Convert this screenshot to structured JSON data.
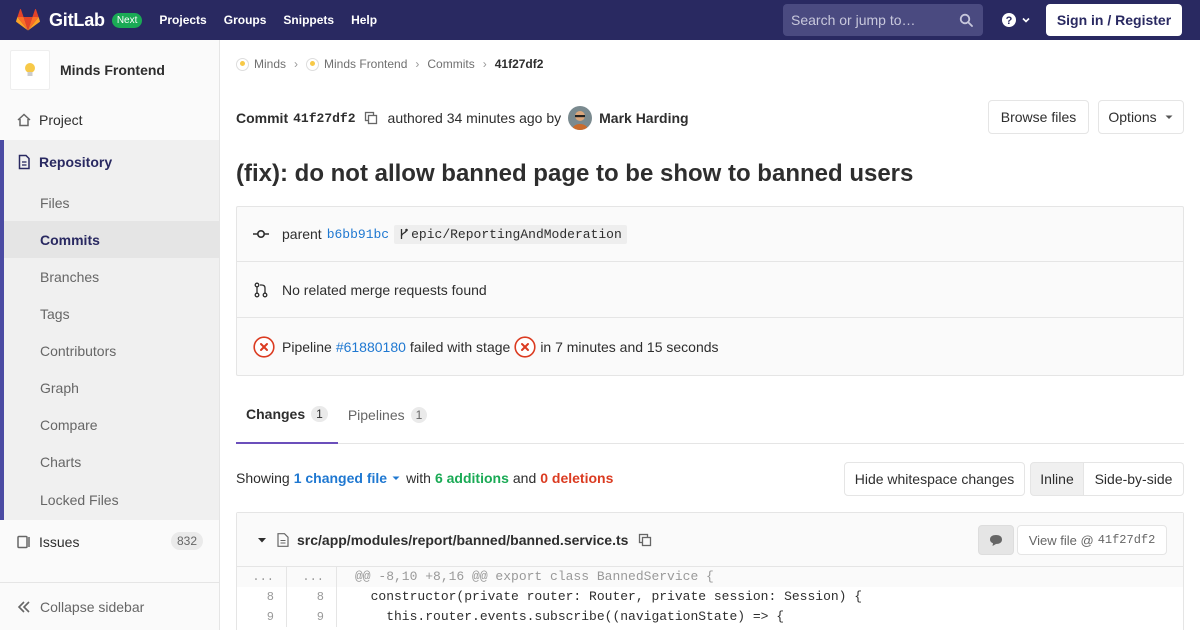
{
  "navbar": {
    "brand": "GitLab",
    "badge": "Next",
    "links": [
      "Projects",
      "Groups",
      "Snippets",
      "Help"
    ],
    "search_placeholder": "Search or jump to…",
    "signin": "Sign in / Register"
  },
  "sidebar": {
    "project_name": "Minds Frontend",
    "project_item": "Project",
    "repository": "Repository",
    "repo_items": [
      "Files",
      "Commits",
      "Branches",
      "Tags",
      "Contributors",
      "Graph",
      "Compare",
      "Charts",
      "Locked Files"
    ],
    "issues": "Issues",
    "issues_count": "832",
    "collapse": "Collapse sidebar"
  },
  "breadcrumb": [
    "Minds",
    "Minds Frontend",
    "Commits",
    "41f27df2"
  ],
  "commit": {
    "label": "Commit",
    "sha": "41f27df2",
    "authored": "authored 34 minutes ago by",
    "author": "Mark Harding",
    "browse_files": "Browse files",
    "options": "Options",
    "title": "(fix): do not allow banned page to be show to banned users"
  },
  "info": {
    "parent_label": "parent",
    "parent_sha": "b6bb91bc",
    "branch": "epic/ReportingAndModeration",
    "merge_requests": "No related merge requests found",
    "pipeline_label": "Pipeline",
    "pipeline_id": "#61880180",
    "pipeline_status": "failed with stage",
    "pipeline_duration": "in 7 minutes and 15 seconds"
  },
  "tabs": [
    {
      "label": "Changes",
      "count": "1"
    },
    {
      "label": "Pipelines",
      "count": "1"
    }
  ],
  "diff_summary": {
    "showing": "Showing",
    "changed": "1 changed file",
    "with": "with",
    "additions": "6 additions",
    "and": "and",
    "deletions": "0 deletions",
    "hide_whitespace": "Hide whitespace changes",
    "inline": "Inline",
    "side_by_side": "Side-by-side"
  },
  "file": {
    "path": "src/app/modules/report/banned/banned.service.ts",
    "view_file": "View file @",
    "view_sha": "41f27df2",
    "lines": [
      {
        "old": "...",
        "new": "...",
        "code": "@@ -8,10 +8,16 @@ export class BannedService {"
      },
      {
        "old": "8",
        "new": "8",
        "code": "  constructor(private router: Router, private session: Session) {"
      },
      {
        "old": "9",
        "new": "9",
        "code": "    this.router.events.subscribe((navigationState) => {"
      }
    ]
  },
  "colors": {
    "navbar": "#292961",
    "accent": "#6b4fbb",
    "link": "#1f78d1",
    "success": "#1aaa55",
    "danger": "#db3b21"
  }
}
